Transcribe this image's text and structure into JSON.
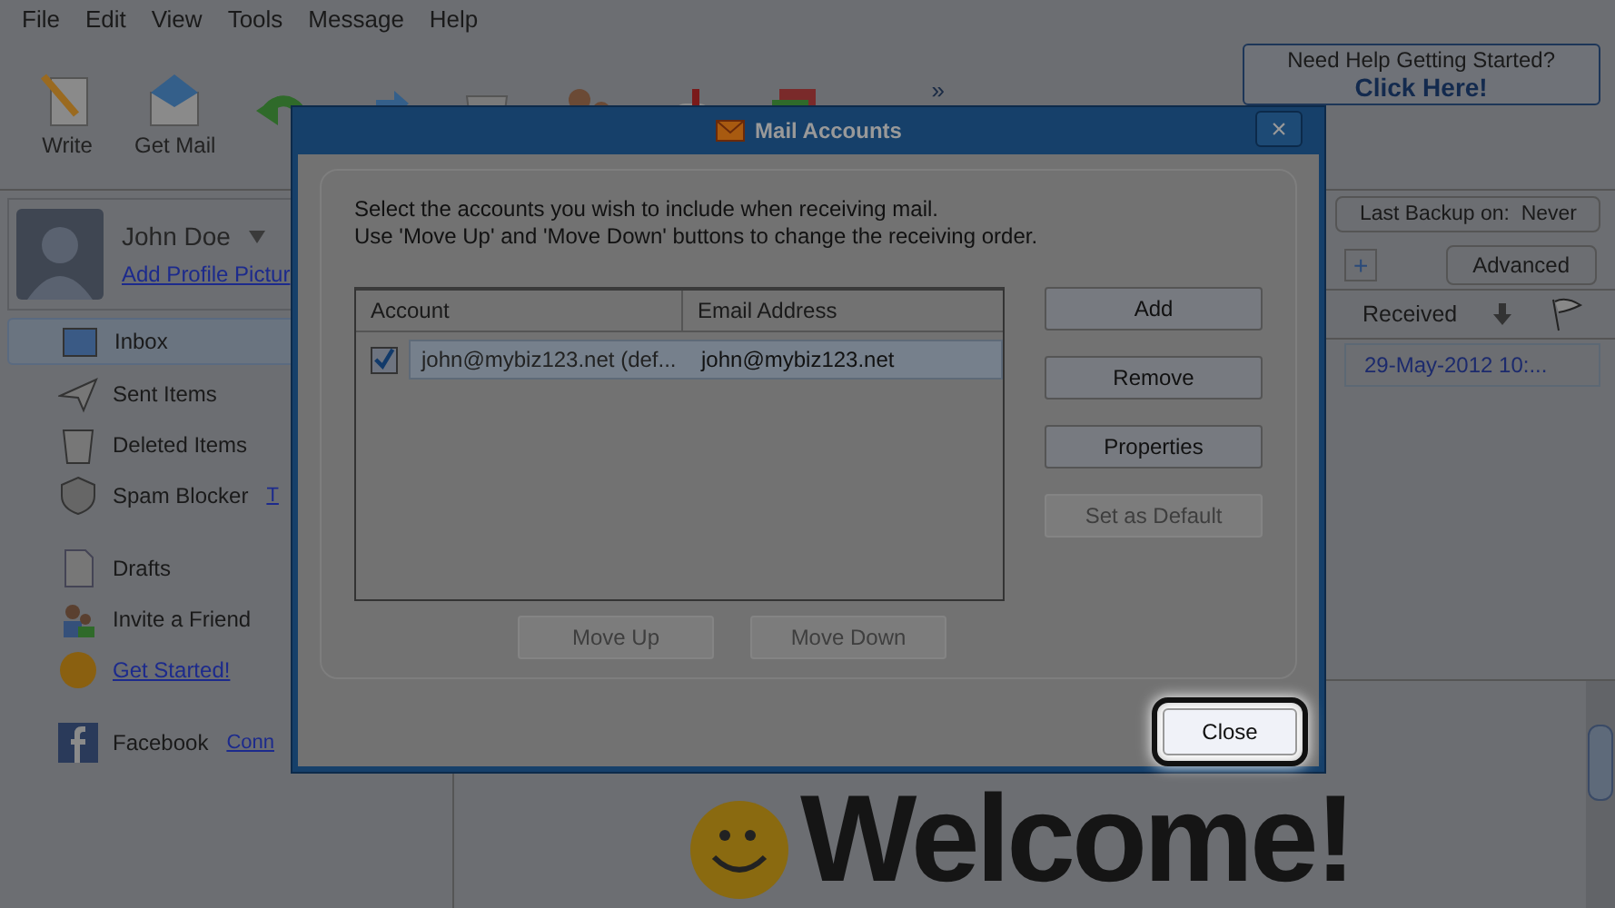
{
  "menu": [
    "File",
    "Edit",
    "View",
    "Tools",
    "Message",
    "Help"
  ],
  "toolbar": [
    {
      "kind": "write",
      "label": "Write"
    },
    {
      "kind": "getmail",
      "label": "Get Mail"
    },
    {
      "kind": "reply"
    },
    {
      "kind": "forward"
    },
    {
      "kind": "delete"
    },
    {
      "kind": "contacts"
    },
    {
      "kind": "mailbox"
    },
    {
      "kind": "calendar"
    }
  ],
  "toolbar_more": "»",
  "help_box": {
    "line1": "Need Help Getting Started?",
    "line2": "Click Here!"
  },
  "profile": {
    "name": "John Doe",
    "link": "Add Profile Pictur"
  },
  "sidebar": {
    "items": [
      {
        "kind": "inbox",
        "label": "Inbox",
        "selected": true
      },
      {
        "kind": "sent",
        "label": "Sent Items",
        "selected": false
      },
      {
        "kind": "deleted",
        "label": "Deleted Items",
        "selected": false
      },
      {
        "kind": "spam",
        "label": "Spam Blocker",
        "selected": false,
        "link": "T"
      },
      {
        "kind": "drafts",
        "label": "Drafts",
        "selected": false
      },
      {
        "kind": "invite",
        "label": "Invite a Friend",
        "selected": false
      },
      {
        "kind": "started",
        "label": "Get Started!",
        "selected": false
      }
    ],
    "facebook": {
      "label": "Facebook",
      "link": "Conn"
    }
  },
  "backup": {
    "label": "Last Backup on:",
    "value": "Never"
  },
  "advanced_button": "Advanced",
  "add_tab": "+",
  "message_list": {
    "column": "Received",
    "rows": [
      {
        "received": "29-May-2012 10:..."
      }
    ]
  },
  "welcome": "Welcome!",
  "dialog": {
    "title": "Mail Accounts",
    "close_glyph": "×",
    "instructions": [
      "Select the accounts you wish to include when receiving mail.",
      "Use 'Move Up' and 'Move Down' buttons to change the receiving order."
    ],
    "columns": [
      "Account",
      "Email Address"
    ],
    "rows": [
      {
        "checked": true,
        "selected": true,
        "account": "john@mybiz123.net (def...",
        "email": "john@mybiz123.net"
      }
    ],
    "side_buttons": [
      {
        "label": "Add",
        "disabled": false
      },
      {
        "label": "Remove",
        "disabled": false
      },
      {
        "label": "Properties",
        "disabled": false
      },
      {
        "label": "Set as Default",
        "disabled": true
      }
    ],
    "order_buttons": [
      {
        "label": "Move Up",
        "disabled": true
      },
      {
        "label": "Move Down",
        "disabled": true
      }
    ],
    "close_button": {
      "label": "Close",
      "focused": true
    }
  }
}
